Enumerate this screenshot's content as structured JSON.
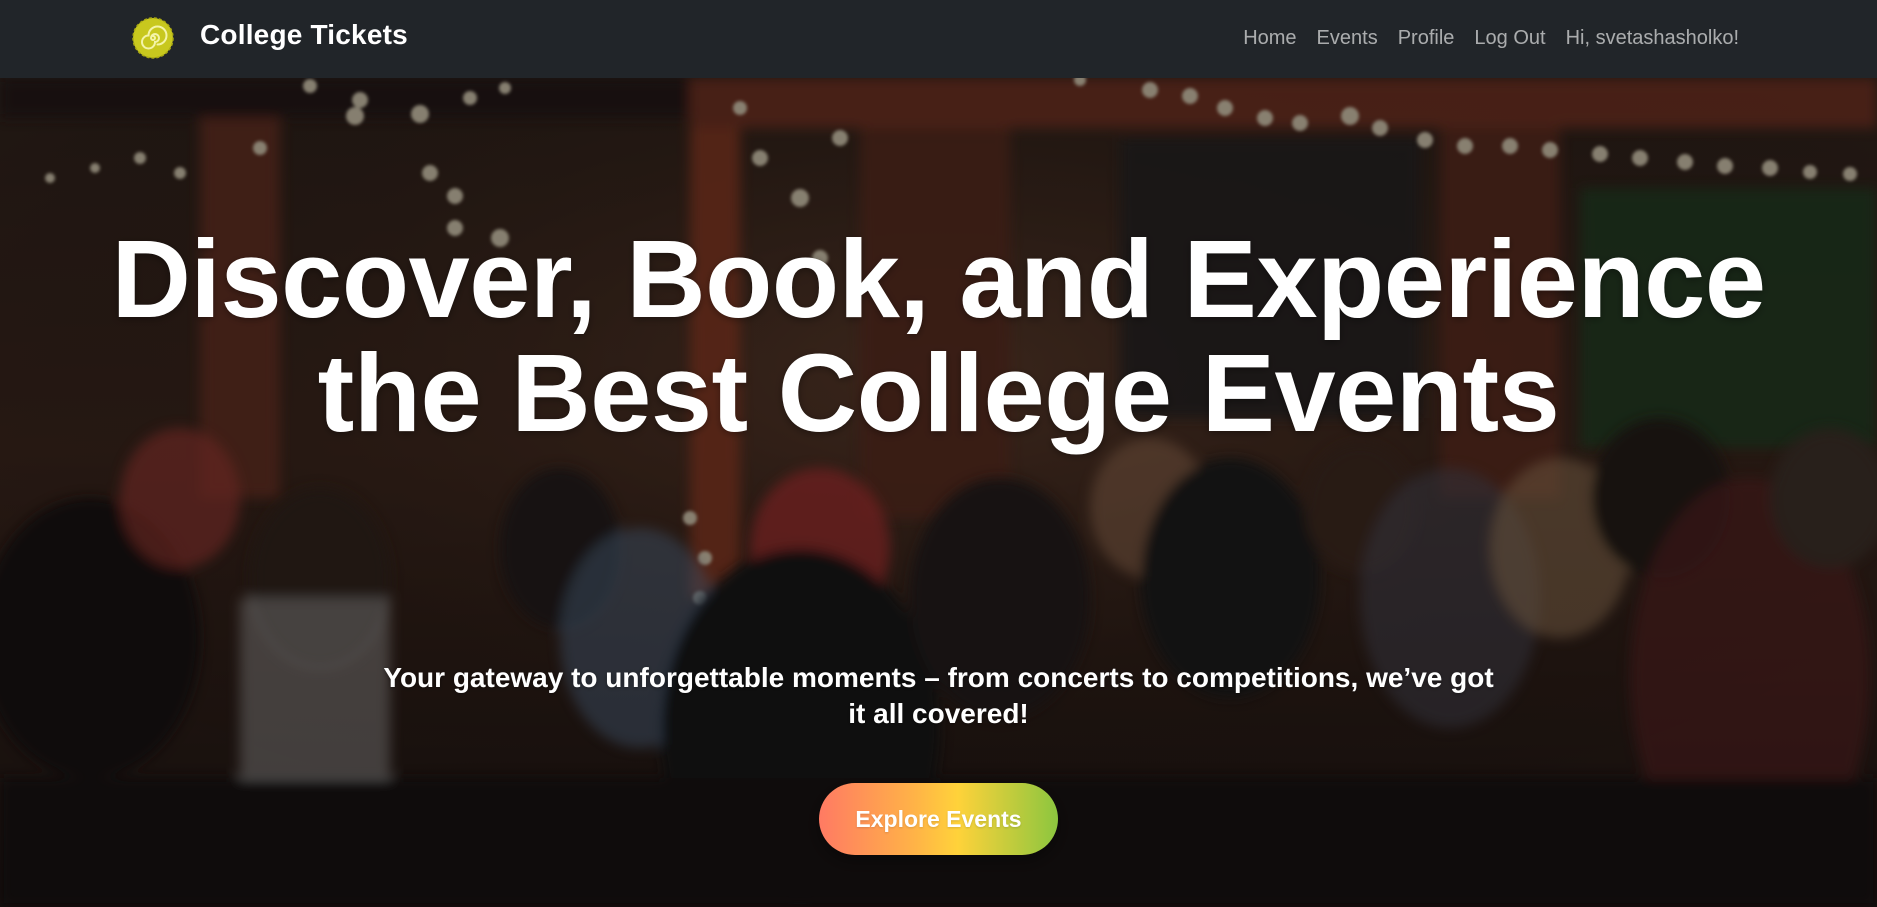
{
  "navbar": {
    "brand_name": "College Tickets",
    "logo_icon": "spiral-logo-icon",
    "links": [
      {
        "label": "Home"
      },
      {
        "label": "Events"
      },
      {
        "label": "Profile"
      },
      {
        "label": "Log Out"
      }
    ],
    "greeting": "Hi, svetashasholko!"
  },
  "hero": {
    "title": "Discover, Book, and Experience the Best College Events",
    "subtitle": "Your gateway to unforgettable moments – from concerts to competitions, we’ve got it all covered!",
    "cta_label": "Explore Events",
    "background": "crowd-of-students-photo"
  },
  "colors": {
    "navbar_bg": "#212529",
    "logo_yellow": "#c8c81e",
    "cta_gradient": [
      "#ff7a63",
      "#ffd23a",
      "#8cc63f"
    ]
  }
}
